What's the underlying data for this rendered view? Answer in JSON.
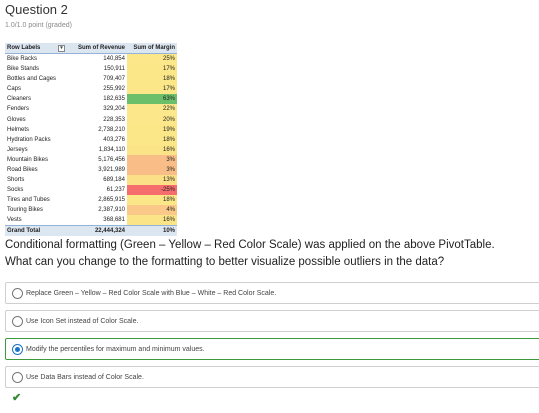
{
  "question": {
    "title": "Question 2",
    "points": "1.0/1.0 point (graded)"
  },
  "pivot": {
    "headers": [
      "Row Labels",
      "Sum of Revenue",
      "Sum of Margin"
    ],
    "rows": [
      {
        "label": "Bike Racks",
        "revenue": "140,854",
        "margin": "25%",
        "color": "#fce88a"
      },
      {
        "label": "Bike Stands",
        "revenue": "150,911",
        "margin": "17%",
        "color": "#fbe688"
      },
      {
        "label": "Bottles and Cages",
        "revenue": "709,407",
        "margin": "18%",
        "color": "#fbe688"
      },
      {
        "label": "Caps",
        "revenue": "255,992",
        "margin": "17%",
        "color": "#fbe688"
      },
      {
        "label": "Cleaners",
        "revenue": "182,635",
        "margin": "63%",
        "color": "#6cbf6a"
      },
      {
        "label": "Fenders",
        "revenue": "329,204",
        "margin": "22%",
        "color": "#fce88a"
      },
      {
        "label": "Gloves",
        "revenue": "228,353",
        "margin": "20%",
        "color": "#fce88a"
      },
      {
        "label": "Helmets",
        "revenue": "2,738,210",
        "margin": "19%",
        "color": "#fbe688"
      },
      {
        "label": "Hydration Packs",
        "revenue": "403,276",
        "margin": "18%",
        "color": "#fbe688"
      },
      {
        "label": "Jerseys",
        "revenue": "1,834,110",
        "margin": "16%",
        "color": "#fbe488"
      },
      {
        "label": "Mountain Bikes",
        "revenue": "5,176,456",
        "margin": "3%",
        "color": "#f9be87"
      },
      {
        "label": "Road Bikes",
        "revenue": "3,921,989",
        "margin": "3%",
        "color": "#f9be87"
      },
      {
        "label": "Shorts",
        "revenue": "689,184",
        "margin": "13%",
        "color": "#fbe088"
      },
      {
        "label": "Socks",
        "revenue": "61,237",
        "margin": "-25%",
        "color": "#f56d6d"
      },
      {
        "label": "Tires and Tubes",
        "revenue": "2,865,915",
        "margin": "18%",
        "color": "#fbe688"
      },
      {
        "label": "Touring Bikes",
        "revenue": "2,387,910",
        "margin": "4%",
        "color": "#fac888"
      },
      {
        "label": "Vests",
        "revenue": "368,681",
        "margin": "16%",
        "color": "#fbe488"
      }
    ],
    "total": {
      "label": "Grand Total",
      "revenue": "22,444,324",
      "margin": "10%"
    }
  },
  "prompt": {
    "line1": "Conditional formatting (Green – Yellow – Red Color Scale) was applied on the above PivotTable.",
    "line2": "What can you change to the formatting to better visualize possible outliers in the data?"
  },
  "options": [
    {
      "text": "Replace Green – Yellow – Red Color Scale with Blue – White – Red Color Scale.",
      "selected": false
    },
    {
      "text": "Use Icon Set instead of Color Scale.",
      "selected": false
    },
    {
      "text": "Modify the percentiles for maximum and minimum values.",
      "selected": true
    },
    {
      "text": "Use Data Bars instead of Color Scale.",
      "selected": false
    }
  ],
  "result": {
    "icon": "checkmark-icon",
    "color": "#2e8b2e"
  }
}
